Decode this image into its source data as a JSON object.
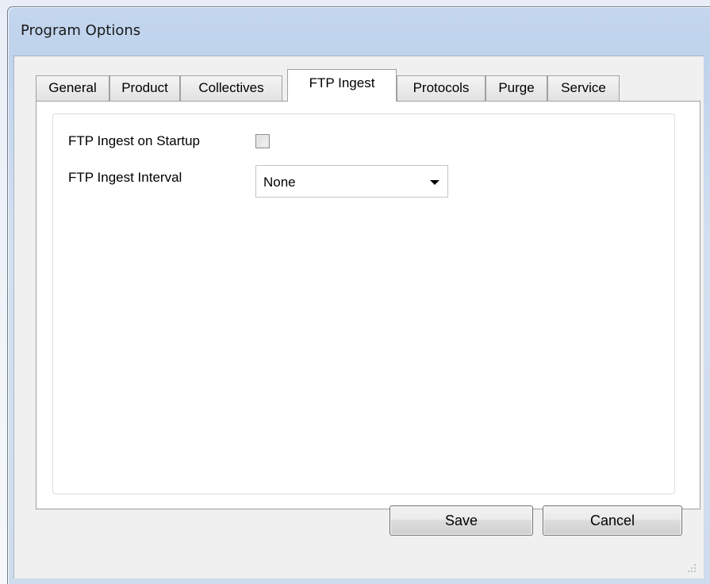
{
  "window": {
    "title": "Program Options"
  },
  "tabs": [
    {
      "label": "General",
      "active": false
    },
    {
      "label": "Product",
      "active": false
    },
    {
      "label": "Collectives",
      "active": false
    },
    {
      "label": "FTP Ingest",
      "active": true
    },
    {
      "label": "Protocols",
      "active": false
    },
    {
      "label": "Purge",
      "active": false
    },
    {
      "label": "Service",
      "active": false
    }
  ],
  "ftp_ingest": {
    "startup_label": "FTP Ingest on Startup",
    "startup_checked": false,
    "interval_label": "FTP Ingest Interval",
    "interval_value": "None"
  },
  "buttons": {
    "save_label": "Save",
    "cancel_label": "Cancel"
  },
  "icons": {
    "combo_arrow": "chevron-down-icon",
    "resize_grip": "resize-grip-icon"
  }
}
